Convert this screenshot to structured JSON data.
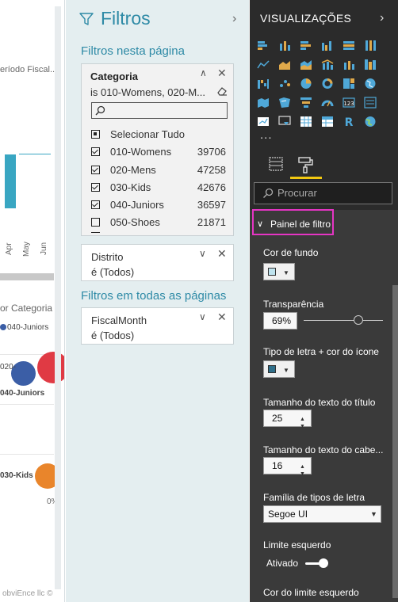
{
  "canvas": {
    "chart1_title": "eríodo Fiscal...",
    "months": [
      "Apr",
      "May",
      "Jun"
    ],
    "chart2_title": "or Categoria",
    "legend_item": "040-Juniors",
    "bubble_label_1": "020-",
    "bubble_label_2": "040-Juniors",
    "bubble_label_3": "030-Kids",
    "axis_label": "0%",
    "footer": "obviEnce llc ©"
  },
  "filters_pane": {
    "title": "Filtros",
    "section_page": "Filtros nesta página",
    "categoria": {
      "title": "Categoria",
      "condition": "is 010-Womens, 020-M...",
      "items": [
        {
          "label": "Selecionar Tudo",
          "count": "",
          "state": "partial"
        },
        {
          "label": "010-Womens",
          "count": "39706",
          "state": "checked"
        },
        {
          "label": "020-Mens",
          "count": "47258",
          "state": "checked"
        },
        {
          "label": "030-Kids",
          "count": "42676",
          "state": "checked"
        },
        {
          "label": "040-Juniors",
          "count": "36597",
          "state": "checked"
        },
        {
          "label": "050-Shoes",
          "count": "21871",
          "state": "unchecked"
        }
      ]
    },
    "distrito": {
      "title": "Distrito",
      "condition": "é (Todos)"
    },
    "section_all": "Filtros em todas as páginas",
    "fiscalmonth": {
      "title": "FiscalMonth",
      "condition": "é (Todos)"
    }
  },
  "viz_pane": {
    "title": "VISUALIZAÇÕES",
    "more": "...",
    "search_placeholder": "Procurar",
    "panel_header": "Painel de filtro",
    "properties": {
      "background_color": "Cor de fundo",
      "transparency": "Transparência",
      "transparency_value": "69%",
      "font_icon_color": "Tipo de letra + cor do ícone",
      "title_text_size": "Tamanho do texto do título",
      "title_text_size_value": "25",
      "header_text_size": "Tamanho do texto do cabe...",
      "header_text_size_value": "16",
      "font_family": "Família de tipos de letra",
      "font_family_value": "Segoe UI",
      "left_border": "Limite esquerdo",
      "left_border_state": "Ativado",
      "left_border_color": "Cor do limite esquerdo"
    },
    "transparency_level": 0.69,
    "colors": {
      "background_swatch": "#bfe3ee",
      "font_swatch": "#2f6f8a",
      "highlight": "#e535c4",
      "accent": "#f2c811"
    }
  }
}
